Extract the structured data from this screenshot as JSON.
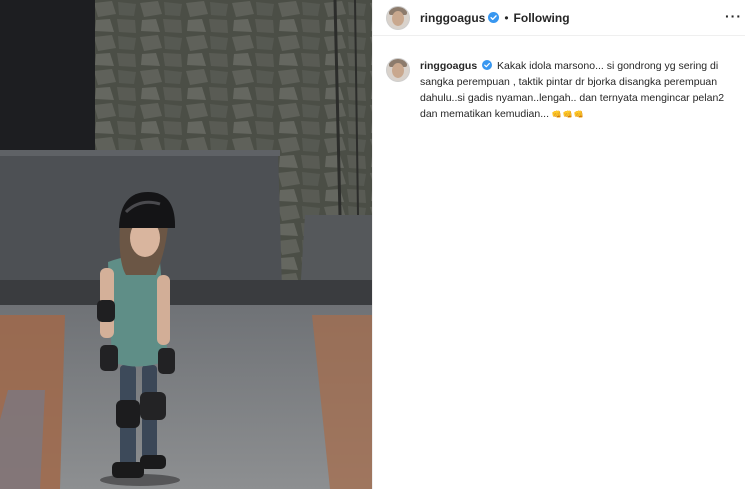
{
  "post": {
    "username": "ringgoagus",
    "separator": "•",
    "follow_state": "Following",
    "more_label": "···"
  },
  "caption": {
    "username": "ringgoagus",
    "text": "Kakak idola marsono... si gondrong yg sering di sangka perempuan , taktik pintar dr bjorka disangka perempuan dahulu..si gadis nyaman..lengah.. dan ternyata mengincar pelan2 dan mematikan kemudian...",
    "emoji": "👊👊👊"
  },
  "colors": {
    "verified": "#3897f0",
    "text": "#262626",
    "border": "#efefef"
  },
  "icons": {
    "verified": "verified-badge-icon",
    "more": "more-options-icon"
  }
}
